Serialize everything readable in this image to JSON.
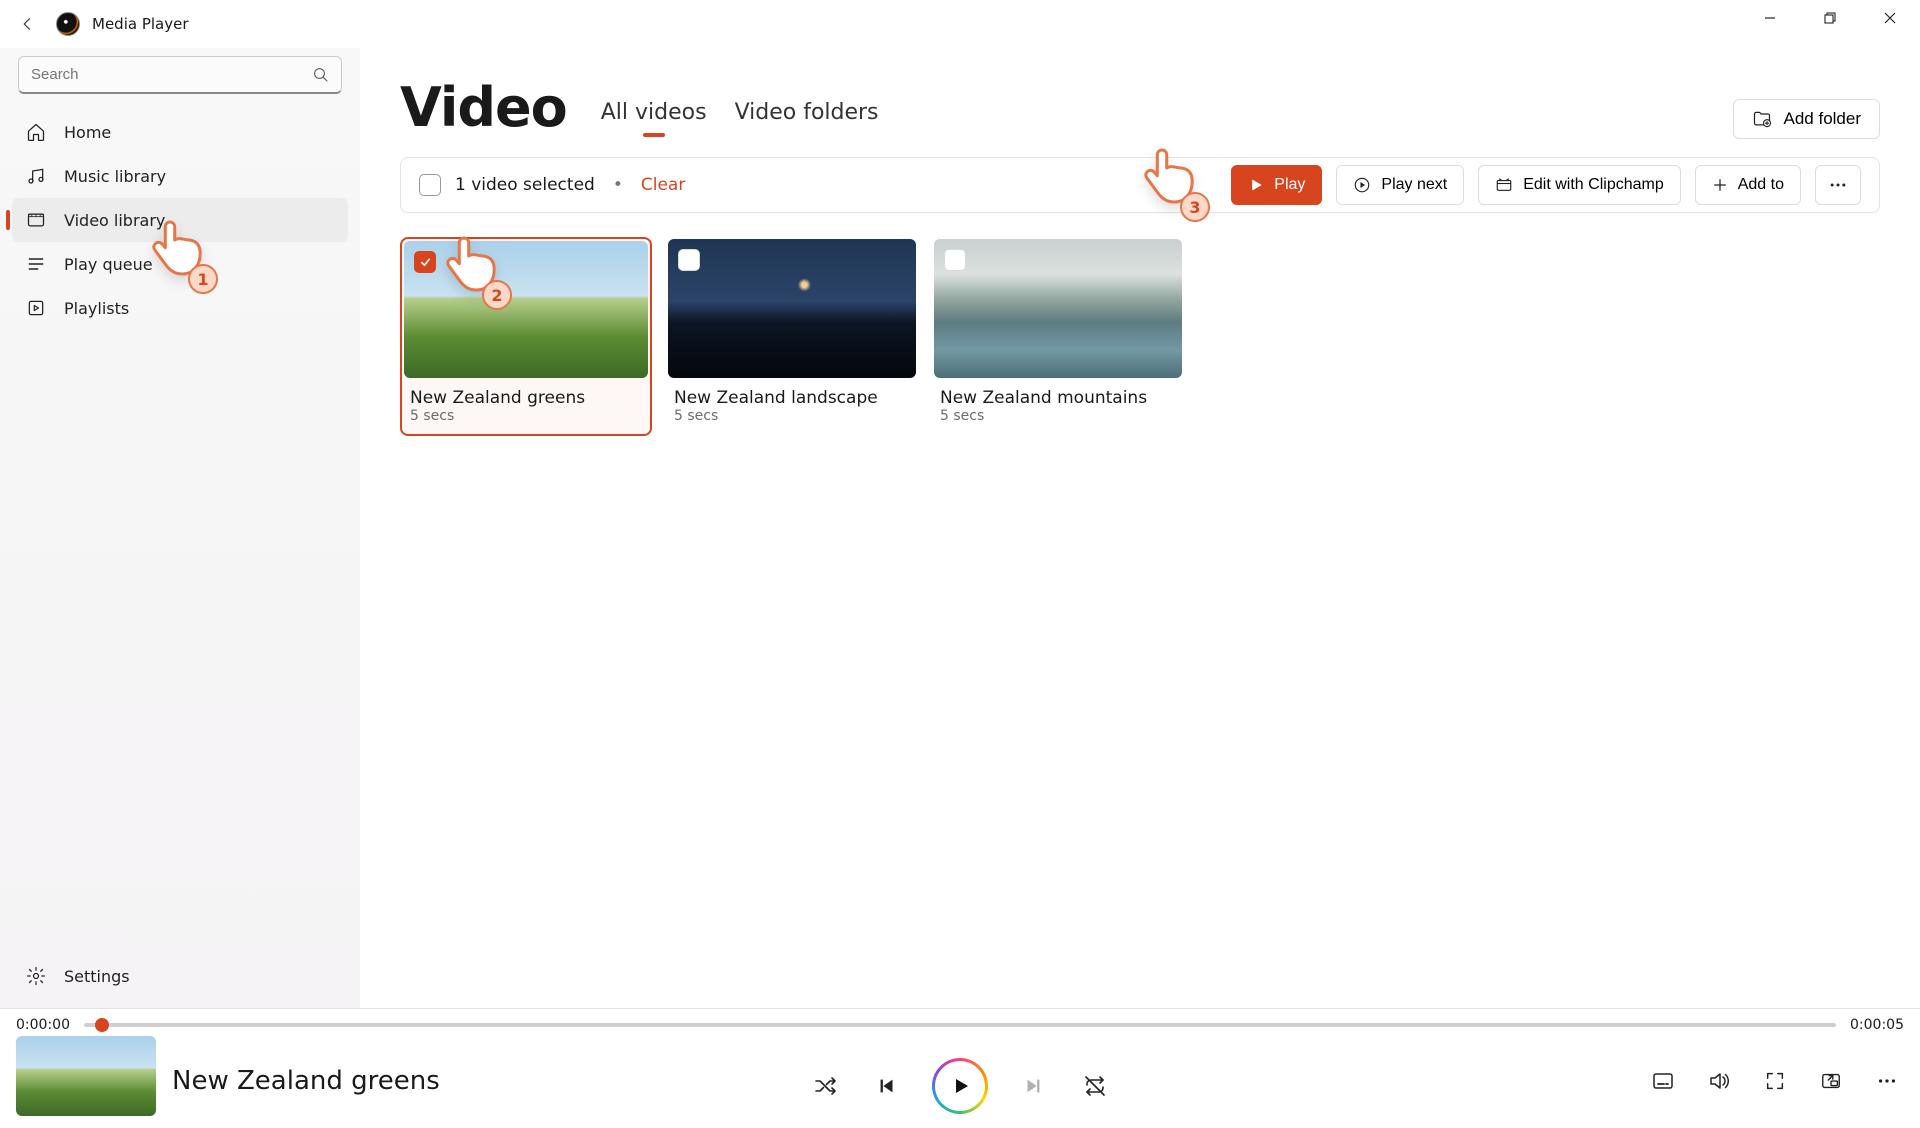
{
  "app": {
    "title": "Media Player"
  },
  "search": {
    "placeholder": "Search"
  },
  "sidebar": {
    "items": [
      {
        "label": "Home"
      },
      {
        "label": "Music library"
      },
      {
        "label": "Video library"
      },
      {
        "label": "Play queue"
      },
      {
        "label": "Playlists"
      }
    ],
    "settings_label": "Settings"
  },
  "main": {
    "title": "Video",
    "tabs": [
      {
        "label": "All videos",
        "active": true
      },
      {
        "label": "Video folders",
        "active": false
      }
    ],
    "add_folder_label": "Add folder"
  },
  "selection_bar": {
    "status": "1 video selected",
    "separator": "•",
    "clear_label": "Clear",
    "play_label": "Play",
    "play_next_label": "Play next",
    "edit_label": "Edit with Clipchamp",
    "add_to_label": "Add to"
  },
  "videos": [
    {
      "title": "New Zealand greens",
      "duration": "5 secs",
      "selected": true,
      "thumb_class": "greens"
    },
    {
      "title": "New Zealand landscape",
      "duration": "5 secs",
      "selected": false,
      "thumb_class": "night"
    },
    {
      "title": "New Zealand mountains",
      "duration": "5 secs",
      "selected": false,
      "thumb_class": "mountains"
    }
  ],
  "player": {
    "current_time": "0:00:00",
    "total_time": "0:00:05",
    "now_playing_title": "New Zealand greens"
  },
  "callouts": {
    "one": "1",
    "two": "2",
    "three": "3"
  },
  "colors": {
    "accent": "#d7451e"
  }
}
